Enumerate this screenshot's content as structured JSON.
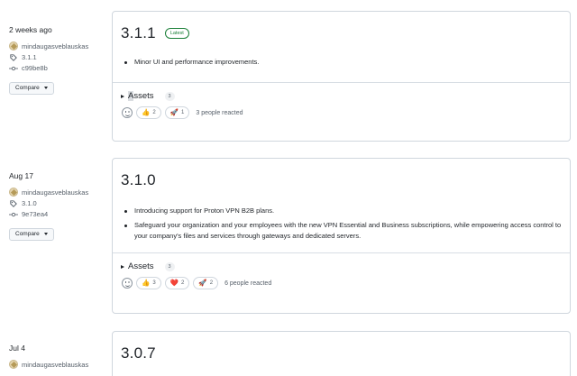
{
  "releases": [
    {
      "date": "2 weeks ago",
      "author": "mindaugasveblauskas",
      "tag": "3.1.1",
      "commit": "c99be8b",
      "compare_label": "Compare",
      "version": "3.1.1",
      "badge": "Latest",
      "notes": [
        "Minor UI and performance improvements."
      ],
      "assets_label": "Assets",
      "assets_count": "3",
      "reactions": [
        {
          "emoji": "👍",
          "count": "2"
        },
        {
          "emoji": "🚀",
          "count": "1"
        }
      ],
      "reacted_text": "3 people reacted"
    },
    {
      "date": "Aug 17",
      "author": "mindaugasveblauskas",
      "tag": "3.1.0",
      "commit": "9e73ea4",
      "compare_label": "Compare",
      "version": "3.1.0",
      "notes": [
        "Introducing support for Proton VPN B2B plans.",
        "Safeguard your organization and your employees with the new VPN Essential and Business subscriptions, while empowering access control to your company's files and services through gateways and dedicated servers."
      ],
      "assets_label": "Assets",
      "assets_count": "3",
      "reactions": [
        {
          "emoji": "👍",
          "count": "3"
        },
        {
          "emoji": "❤️",
          "count": "2"
        },
        {
          "emoji": "🚀",
          "count": "2"
        }
      ],
      "reacted_text": "6 people reacted"
    },
    {
      "date": "Jul 4",
      "author": "mindaugasveblauskas",
      "version": "3.0.7"
    }
  ]
}
